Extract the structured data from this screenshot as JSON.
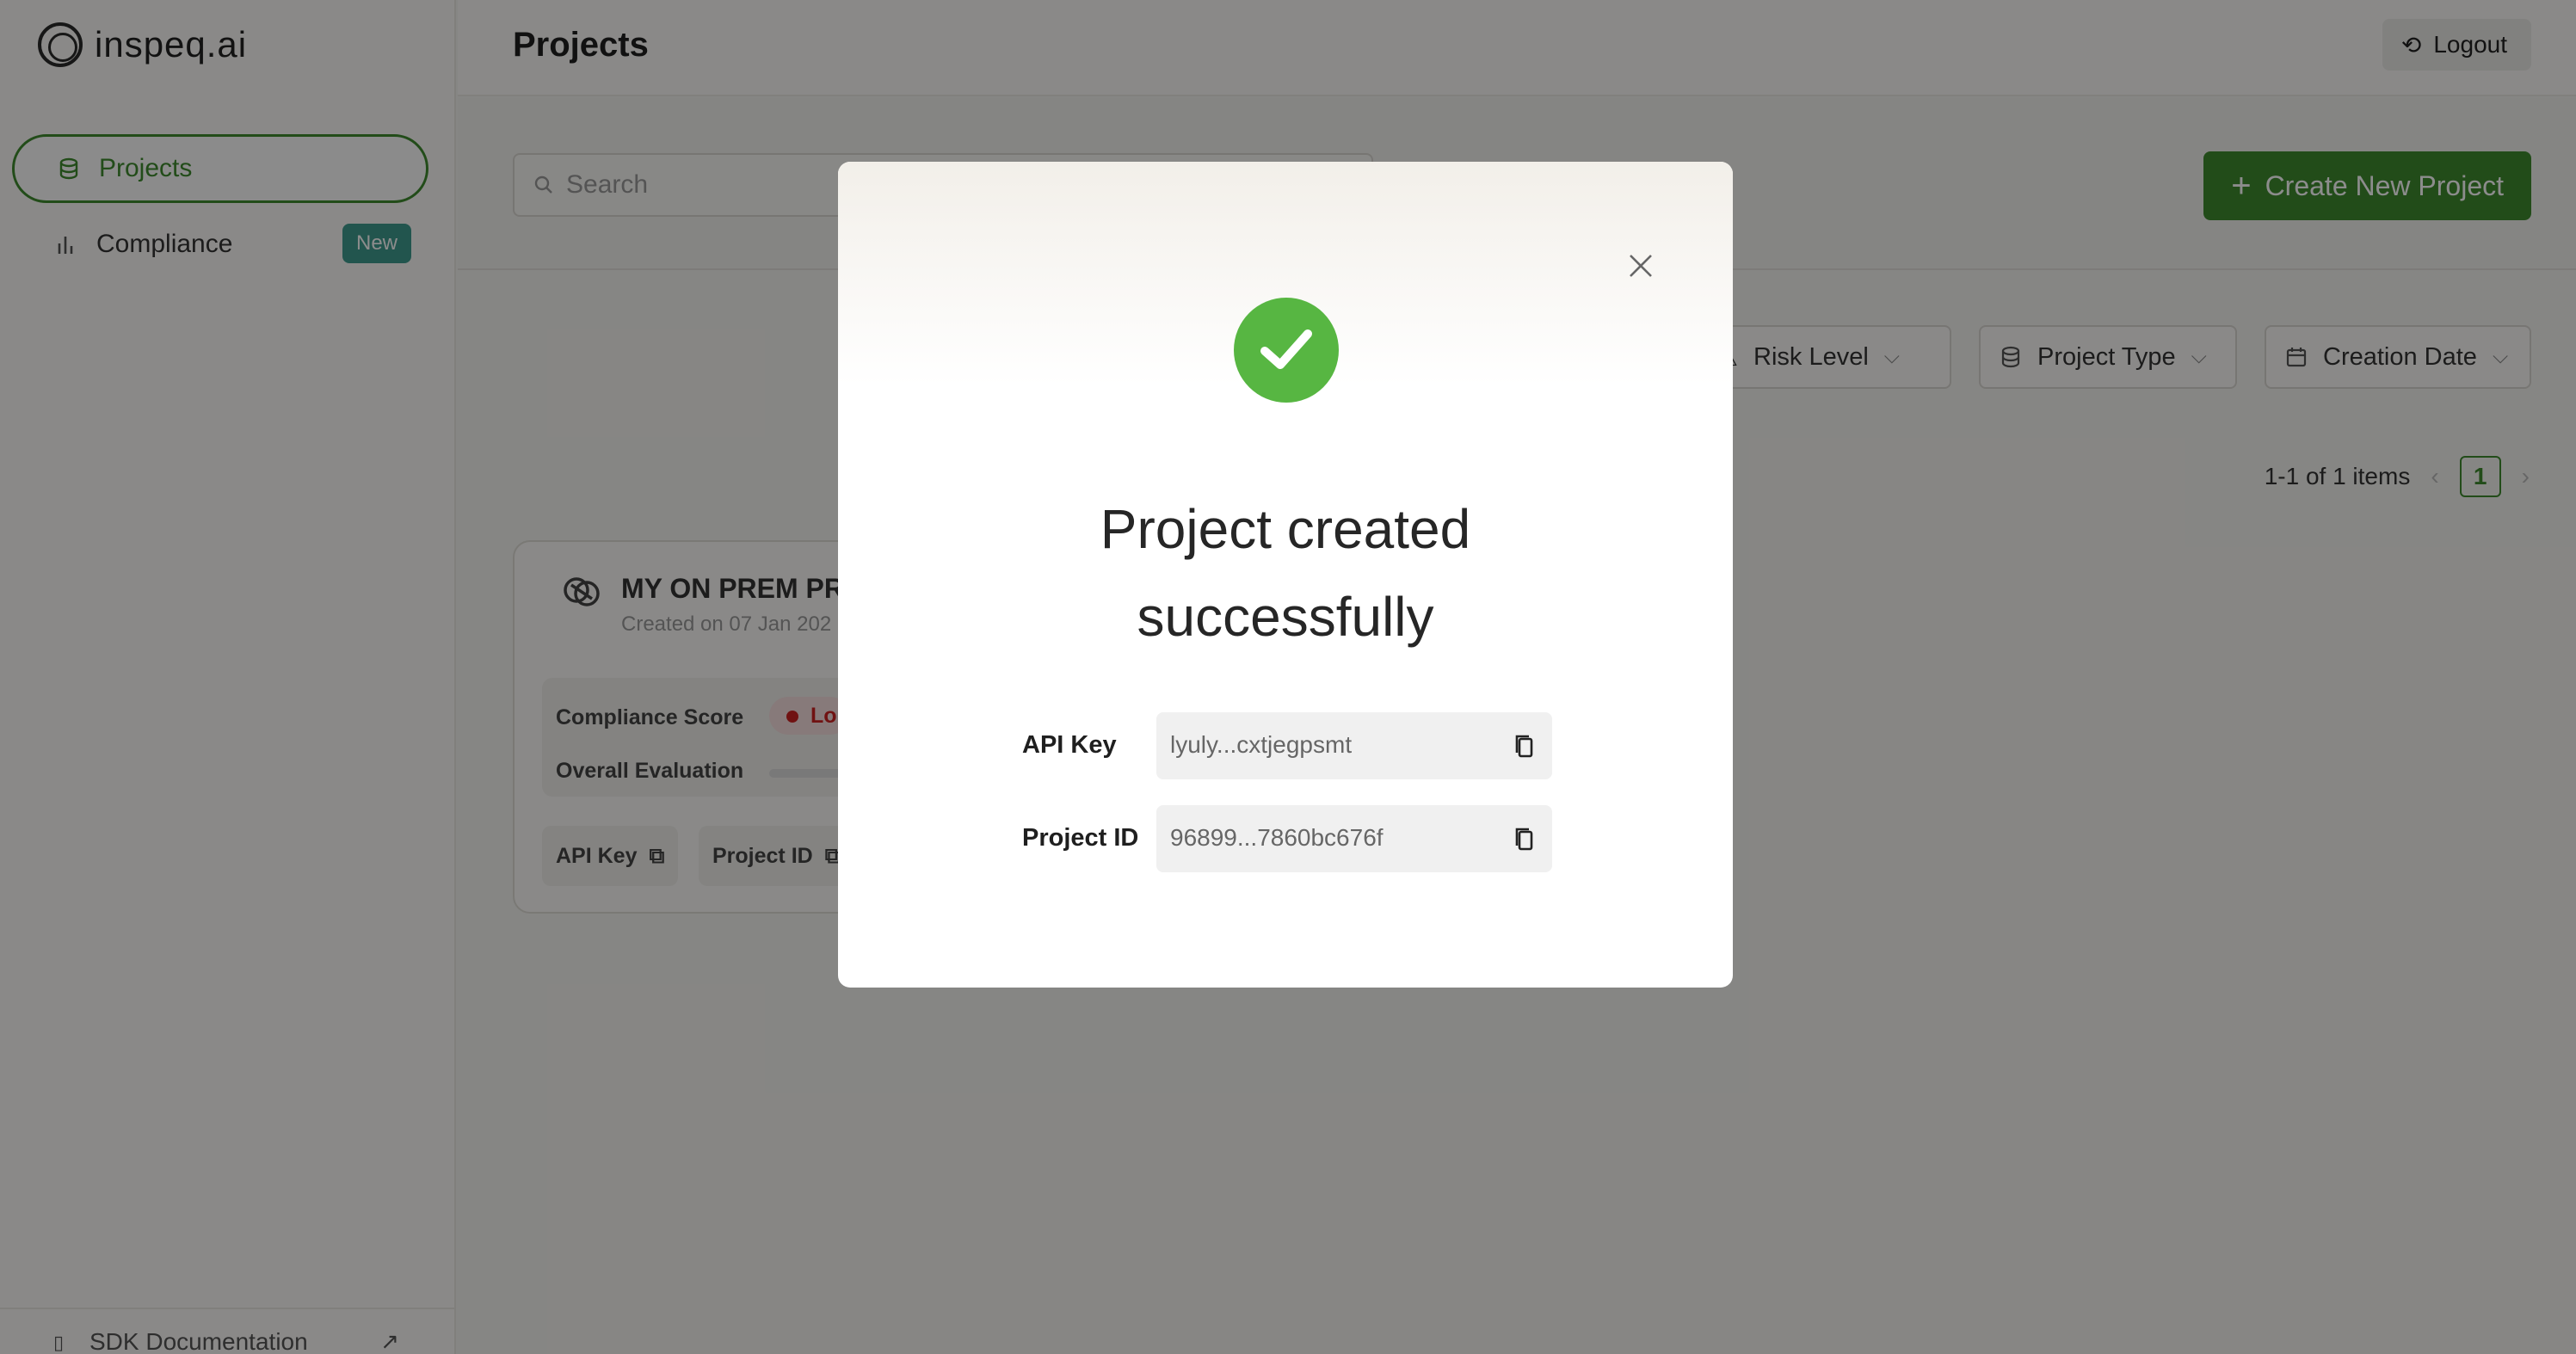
{
  "app": {
    "logo_text": "inspeq.ai"
  },
  "sidebar": {
    "items": [
      {
        "label": "Projects",
        "icon": "database-icon",
        "active": true
      },
      {
        "label": "Compliance",
        "icon": "bar-chart-icon",
        "badge": "New"
      }
    ],
    "footer_label": "SDK Documentation"
  },
  "header": {
    "title": "Projects",
    "logout_label": "Logout"
  },
  "toolbar": {
    "search_placeholder": "Search",
    "create_label": "Create New Project"
  },
  "filters": [
    {
      "label": "Risk Level",
      "icon": "risk-icon"
    },
    {
      "label": "Project Type",
      "icon": "database-icon"
    },
    {
      "label": "Creation Date",
      "icon": "calendar-icon"
    }
  ],
  "pagination": {
    "summary": "1-1 of 1 items",
    "current_page": "1"
  },
  "project_card": {
    "title": "MY ON PREM PR",
    "created": "Created on 07 Jan 202",
    "compliance_score_label": "Compliance Score",
    "risk_label": "Lo",
    "overall_evaluation_label": "Overall Evaluation",
    "api_key_chip": "API Key",
    "project_id_chip": "Project ID"
  },
  "modal": {
    "title_line1": "Project created",
    "title_line2": "successfully",
    "api_key_label": "API Key",
    "api_key_value": "lyuly...cxtjegpsmt",
    "project_id_label": "Project ID",
    "project_id_value": "96899...7860bc676f",
    "status_color": "#57b642"
  },
  "colors": {
    "brand_green": "#3e8a2f",
    "badge_teal": "#3f9b8f",
    "risk_red": "#cc2222"
  }
}
